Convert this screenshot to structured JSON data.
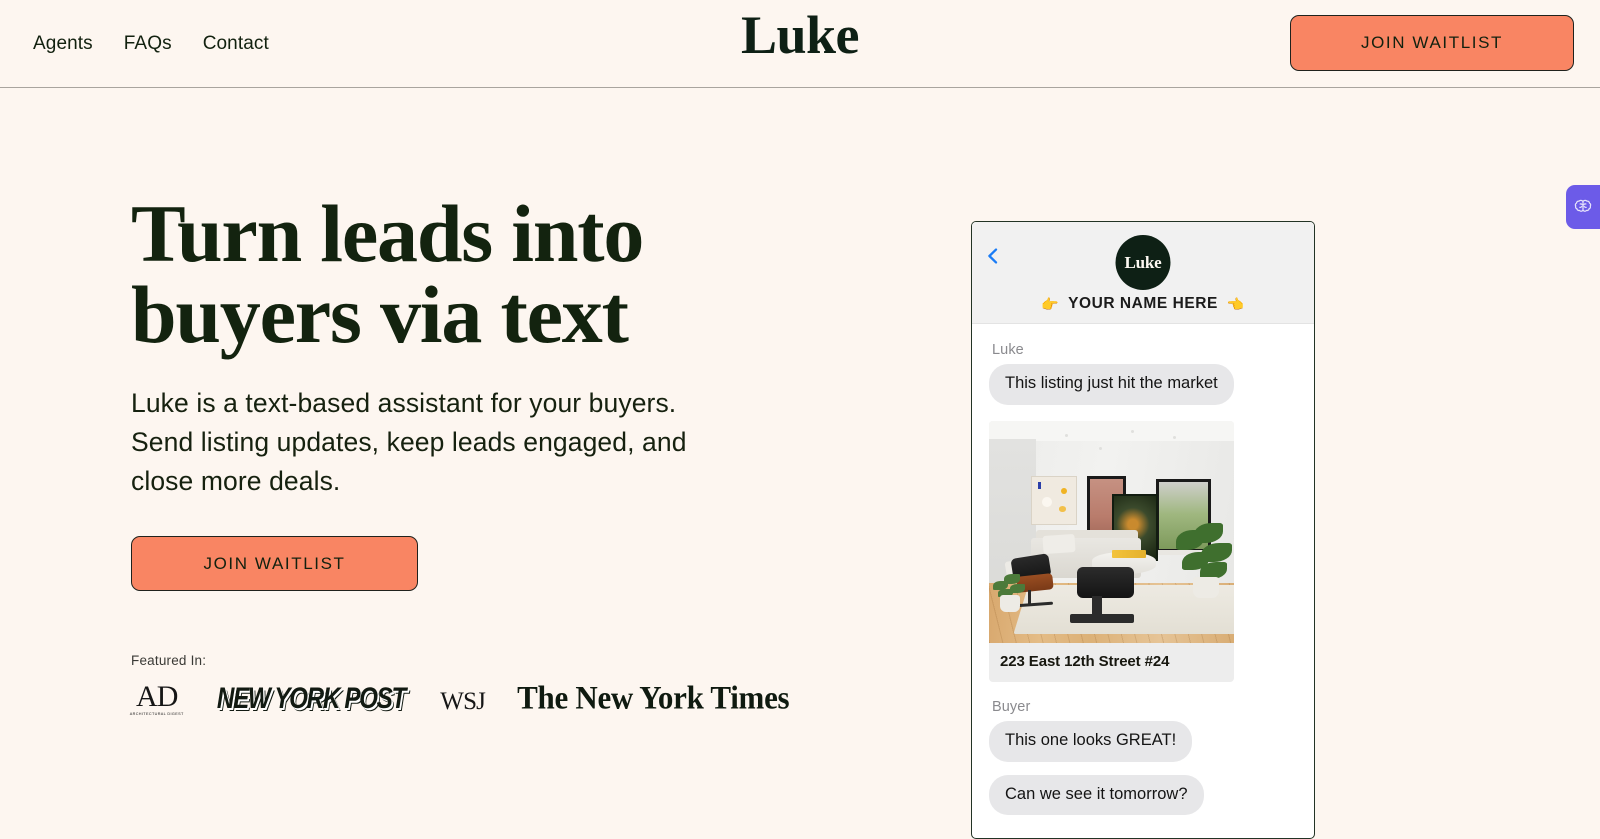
{
  "theme": {
    "page_bg": "#FDF6F0",
    "ink": "#12210F",
    "brand_green": "#0E2015",
    "accent_coral": "#F98563",
    "widget_purple": "#6C5BE8",
    "bubble_gray": "#E7E7E9",
    "phone_header_gray": "#F1F1F1",
    "chat_link_blue": "#1A7CF6"
  },
  "header": {
    "nav": [
      {
        "label": "Agents",
        "name": "nav-agents"
      },
      {
        "label": "FAQs",
        "name": "nav-faqs"
      },
      {
        "label": "Contact",
        "name": "nav-contact"
      }
    ],
    "brand": "Luke",
    "cta_label": "JOIN WAITLIST"
  },
  "hero": {
    "headline": "Turn leads into buyers via text",
    "subhead": "Luke is a text-based assistant for your buyers. Send listing updates, keep leads engaged, and close more deals.",
    "cta_label": "JOIN WAITLIST"
  },
  "featured": {
    "label": "Featured In:",
    "logos": [
      {
        "name": "logo-architectural-digest",
        "main": "AD",
        "sub": "ARCHITECTURAL DIGEST"
      },
      {
        "name": "logo-new-york-post",
        "main": "NEW YORK POST"
      },
      {
        "name": "logo-wsj",
        "main": "WSJ"
      },
      {
        "name": "logo-new-york-times",
        "main": "The New York Times"
      }
    ]
  },
  "phone": {
    "back_icon": "chevron-left-icon",
    "avatar_label": "Luke",
    "contact_name": "YOUR NAME HERE",
    "hand_left": "👉",
    "hand_right": "👈",
    "thread": [
      {
        "sender": "Luke",
        "messages": [
          "This listing just hit the market"
        ]
      },
      {
        "sender": "Buyer",
        "messages": [
          "This one looks GREAT!",
          "Can we see it tomorrow?"
        ]
      }
    ],
    "listing": {
      "address": "223 East 12th Street #24",
      "photo_alt": "living-room-listing-photo"
    }
  },
  "widget": {
    "icon": "brain-icon"
  }
}
